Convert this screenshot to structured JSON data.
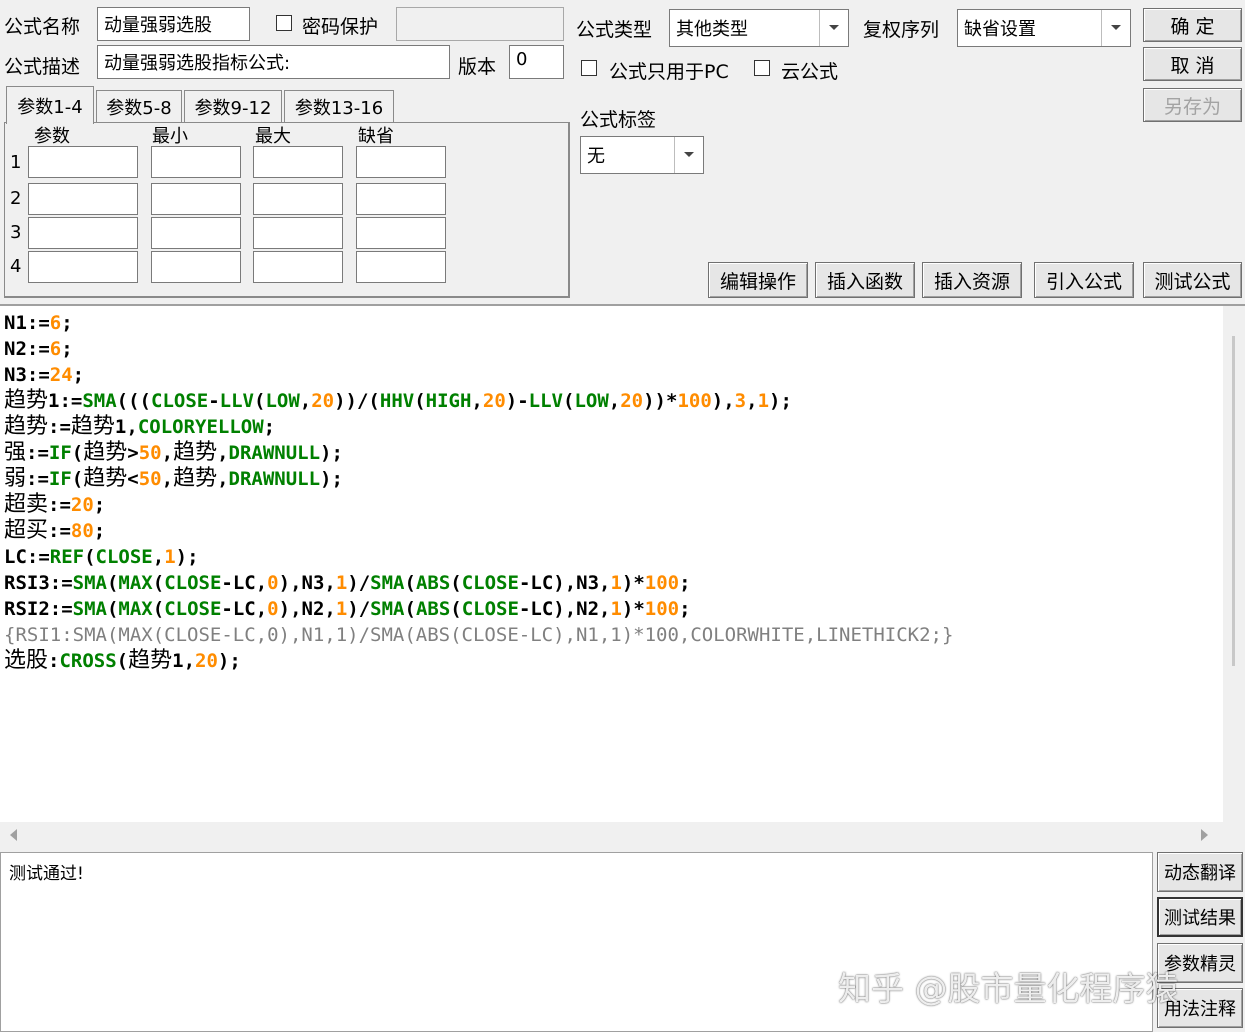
{
  "header": {
    "name_label": "公式名称",
    "name_value": "动量强弱选股",
    "password_label": "密码保护",
    "password_value": "",
    "desc_label": "公式描述",
    "desc_value": "动量强弱选股指标公式:",
    "version_label": "版本",
    "version_value": "0",
    "type_label": "公式类型",
    "type_value": "其他类型",
    "rights_label": "复权序列",
    "rights_value": "缺省设置",
    "pc_only_label": "公式只用于PC",
    "cloud_label": "云公式",
    "tag_label": "公式标签",
    "tag_value": "无"
  },
  "buttons": {
    "ok": "确 定",
    "cancel": "取 消",
    "save_as": "另存为",
    "edit_op": "编辑操作",
    "insert_func": "插入函数",
    "insert_res": "插入资源",
    "import_formula": "引入公式",
    "test_formula": "测试公式",
    "dyn_translate": "动态翻译",
    "test_result": "测试结果",
    "param_wizard": "参数精灵",
    "usage_notes": "用法注释"
  },
  "params": {
    "tabs": [
      "参数1-4",
      "参数5-8",
      "参数9-12",
      "参数13-16"
    ],
    "columns": [
      "参数",
      "最小",
      "最大",
      "缺省"
    ],
    "rows": [
      "1",
      "2",
      "3",
      "4"
    ]
  },
  "code_lines": [
    [
      {
        "t": "N1:=",
        "c": "k"
      },
      {
        "t": "6",
        "c": "n"
      },
      {
        "t": ";",
        "c": "k"
      }
    ],
    [
      {
        "t": "N2:=",
        "c": "k"
      },
      {
        "t": "6",
        "c": "n"
      },
      {
        "t": ";",
        "c": "k"
      }
    ],
    [
      {
        "t": "N3:=",
        "c": "k"
      },
      {
        "t": "24",
        "c": "n"
      },
      {
        "t": ";",
        "c": "k"
      }
    ],
    [
      {
        "t": "趋势",
        "c": "cn"
      },
      {
        "t": "1:=",
        "c": "k"
      },
      {
        "t": "SMA",
        "c": "f"
      },
      {
        "t": "(((",
        "c": "k"
      },
      {
        "t": "CLOSE",
        "c": "f"
      },
      {
        "t": "-",
        "c": "k"
      },
      {
        "t": "LLV",
        "c": "f"
      },
      {
        "t": "(",
        "c": "k"
      },
      {
        "t": "LOW",
        "c": "f"
      },
      {
        "t": ",",
        "c": "k"
      },
      {
        "t": "20",
        "c": "n"
      },
      {
        "t": "))/(",
        "c": "k"
      },
      {
        "t": "HHV",
        "c": "f"
      },
      {
        "t": "(",
        "c": "k"
      },
      {
        "t": "HIGH",
        "c": "f"
      },
      {
        "t": ",",
        "c": "k"
      },
      {
        "t": "20",
        "c": "n"
      },
      {
        "t": ")-",
        "c": "k"
      },
      {
        "t": "LLV",
        "c": "f"
      },
      {
        "t": "(",
        "c": "k"
      },
      {
        "t": "LOW",
        "c": "f"
      },
      {
        "t": ",",
        "c": "k"
      },
      {
        "t": "20",
        "c": "n"
      },
      {
        "t": "))*",
        "c": "k"
      },
      {
        "t": "100",
        "c": "n"
      },
      {
        "t": "),",
        "c": "k"
      },
      {
        "t": "3",
        "c": "n"
      },
      {
        "t": ",",
        "c": "k"
      },
      {
        "t": "1",
        "c": "n"
      },
      {
        "t": ");",
        "c": "k"
      }
    ],
    [
      {
        "t": "趋势",
        "c": "cn"
      },
      {
        "t": ":=",
        "c": "k"
      },
      {
        "t": "趋势",
        "c": "cn"
      },
      {
        "t": "1,",
        "c": "k"
      },
      {
        "t": "COLORYELLOW",
        "c": "f"
      },
      {
        "t": ";",
        "c": "k"
      }
    ],
    [
      {
        "t": "强",
        "c": "cn"
      },
      {
        "t": ":=",
        "c": "k"
      },
      {
        "t": "IF",
        "c": "f"
      },
      {
        "t": "(",
        "c": "k"
      },
      {
        "t": "趋势",
        "c": "cn"
      },
      {
        "t": ">",
        "c": "k"
      },
      {
        "t": "50",
        "c": "n"
      },
      {
        "t": ",",
        "c": "k"
      },
      {
        "t": "趋势",
        "c": "cn"
      },
      {
        "t": ",",
        "c": "k"
      },
      {
        "t": "DRAWNULL",
        "c": "f"
      },
      {
        "t": ");",
        "c": "k"
      }
    ],
    [
      {
        "t": "弱",
        "c": "cn"
      },
      {
        "t": ":=",
        "c": "k"
      },
      {
        "t": "IF",
        "c": "f"
      },
      {
        "t": "(",
        "c": "k"
      },
      {
        "t": "趋势",
        "c": "cn"
      },
      {
        "t": "<",
        "c": "k"
      },
      {
        "t": "50",
        "c": "n"
      },
      {
        "t": ",",
        "c": "k"
      },
      {
        "t": "趋势",
        "c": "cn"
      },
      {
        "t": ",",
        "c": "k"
      },
      {
        "t": "DRAWNULL",
        "c": "f"
      },
      {
        "t": ");",
        "c": "k"
      }
    ],
    [
      {
        "t": "超卖",
        "c": "cn"
      },
      {
        "t": ":=",
        "c": "k"
      },
      {
        "t": "20",
        "c": "n"
      },
      {
        "t": ";",
        "c": "k"
      }
    ],
    [
      {
        "t": "超买",
        "c": "cn"
      },
      {
        "t": ":=",
        "c": "k"
      },
      {
        "t": "80",
        "c": "n"
      },
      {
        "t": ";",
        "c": "k"
      }
    ],
    [
      {
        "t": "LC:=",
        "c": "k"
      },
      {
        "t": "REF",
        "c": "f"
      },
      {
        "t": "(",
        "c": "k"
      },
      {
        "t": "CLOSE",
        "c": "f"
      },
      {
        "t": ",",
        "c": "k"
      },
      {
        "t": "1",
        "c": "n"
      },
      {
        "t": ");",
        "c": "k"
      }
    ],
    [
      {
        "t": "RSI3:=",
        "c": "k"
      },
      {
        "t": "SMA",
        "c": "f"
      },
      {
        "t": "(",
        "c": "k"
      },
      {
        "t": "MAX",
        "c": "f"
      },
      {
        "t": "(",
        "c": "k"
      },
      {
        "t": "CLOSE",
        "c": "f"
      },
      {
        "t": "-LC,",
        "c": "k"
      },
      {
        "t": "0",
        "c": "n"
      },
      {
        "t": "),N3,",
        "c": "k"
      },
      {
        "t": "1",
        "c": "n"
      },
      {
        "t": ")/",
        "c": "k"
      },
      {
        "t": "SMA",
        "c": "f"
      },
      {
        "t": "(",
        "c": "k"
      },
      {
        "t": "ABS",
        "c": "f"
      },
      {
        "t": "(",
        "c": "k"
      },
      {
        "t": "CLOSE",
        "c": "f"
      },
      {
        "t": "-LC),N3,",
        "c": "k"
      },
      {
        "t": "1",
        "c": "n"
      },
      {
        "t": ")*",
        "c": "k"
      },
      {
        "t": "100",
        "c": "n"
      },
      {
        "t": ";",
        "c": "k"
      }
    ],
    [
      {
        "t": "RSI2:=",
        "c": "k"
      },
      {
        "t": "SMA",
        "c": "f"
      },
      {
        "t": "(",
        "c": "k"
      },
      {
        "t": "MAX",
        "c": "f"
      },
      {
        "t": "(",
        "c": "k"
      },
      {
        "t": "CLOSE",
        "c": "f"
      },
      {
        "t": "-LC,",
        "c": "k"
      },
      {
        "t": "0",
        "c": "n"
      },
      {
        "t": "),N2,",
        "c": "k"
      },
      {
        "t": "1",
        "c": "n"
      },
      {
        "t": ")/",
        "c": "k"
      },
      {
        "t": "SMA",
        "c": "f"
      },
      {
        "t": "(",
        "c": "k"
      },
      {
        "t": "ABS",
        "c": "f"
      },
      {
        "t": "(",
        "c": "k"
      },
      {
        "t": "CLOSE",
        "c": "f"
      },
      {
        "t": "-LC),N2,",
        "c": "k"
      },
      {
        "t": "1",
        "c": "n"
      },
      {
        "t": ")*",
        "c": "k"
      },
      {
        "t": "100",
        "c": "n"
      },
      {
        "t": ";",
        "c": "k"
      }
    ],
    [
      {
        "t": "{RSI1:SMA(MAX(CLOSE-LC,0),N1,1)/SMA(ABS(CLOSE-LC),N1,1)*100,COLORWHITE,LINETHICK2;}",
        "c": "cm"
      }
    ],
    [
      {
        "t": "选股",
        "c": "cn"
      },
      {
        "t": ":",
        "c": "k"
      },
      {
        "t": "CROSS",
        "c": "f"
      },
      {
        "t": "(",
        "c": "k"
      },
      {
        "t": "趋势",
        "c": "cn"
      },
      {
        "t": "1,",
        "c": "k"
      },
      {
        "t": "20",
        "c": "n"
      },
      {
        "t": ");",
        "c": "k"
      }
    ]
  ],
  "code_colors": {
    "k": "#000000",
    "n": "#ff8c00",
    "f": "#008000",
    "cn": "#000000",
    "cm": "#808080"
  },
  "result_text": "测试通过!",
  "watermark": "知乎 @股市量化程序猿"
}
